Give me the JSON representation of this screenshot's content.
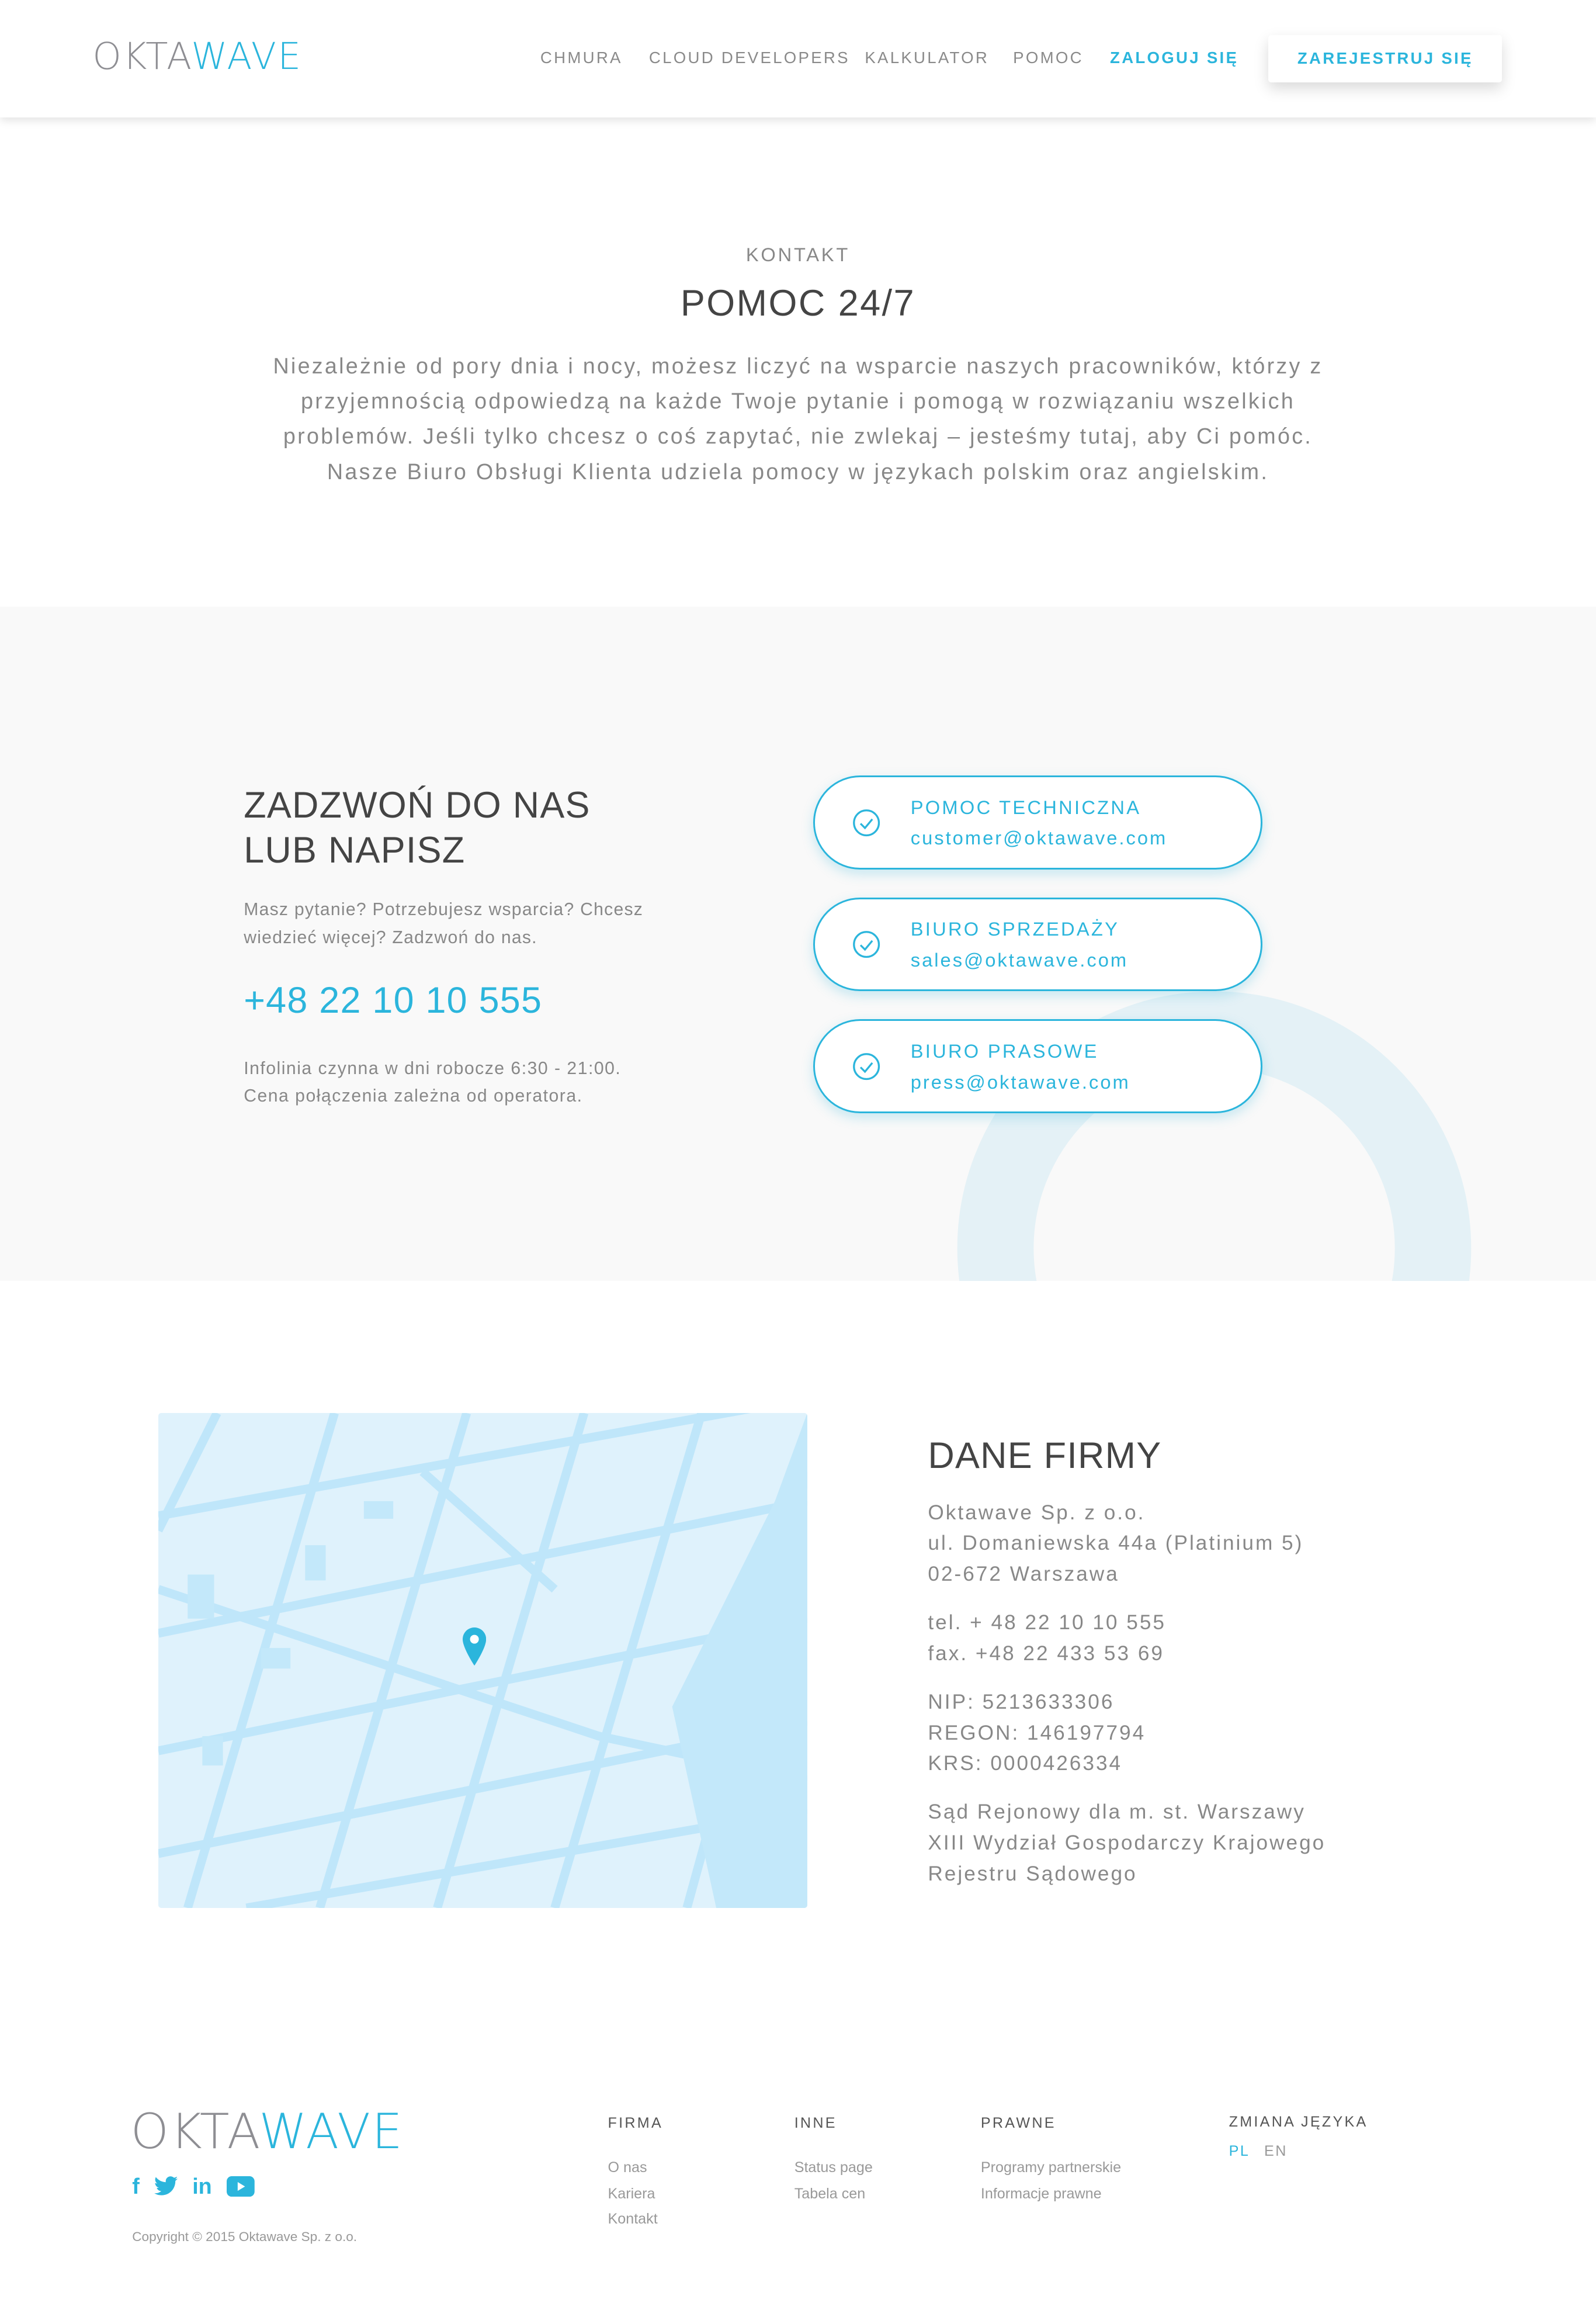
{
  "header": {
    "logo": {
      "part1": "OKTA",
      "part2": "WAVE"
    },
    "nav": [
      {
        "label": "CHMURA"
      },
      {
        "label": "CLOUD DEVELOPERS"
      },
      {
        "label": "KALKULATOR"
      },
      {
        "label": "POMOC"
      },
      {
        "label": "ZALOGUJ SIĘ"
      }
    ],
    "register_label": "ZAREJESTRUJ SIĘ"
  },
  "intro": {
    "eyebrow": "KONTAKT",
    "title": "POMOC 24/7",
    "lines": [
      "Niezależnie od pory dnia i nocy, możesz liczyć na wsparcie naszych pracowników, którzy z",
      "przyjemnością odpowiedzą na każde Twoje pytanie i pomogą w rozwiązaniu wszelkich",
      "problemów. Jeśli tylko chcesz o coś zapytać, nie zwlekaj – jesteśmy tutaj, aby Ci pomóc.",
      "Nasze Biuro Obsługi Klienta udziela pomocy w językach polskim oraz angielskim."
    ]
  },
  "contact": {
    "title_lines": [
      "ZADZWOŃ DO NAS",
      "LUB NAPISZ"
    ],
    "desc_lines": [
      "Masz pytanie? Potrzebujesz wsparcia? Chcesz",
      "wiedzieć więcej? Zadzwoń do nas."
    ],
    "phone": "+48 22 10 10 555",
    "hours_lines": [
      "Infolinia czynna w dni robocze 6:30 - 21:00.",
      "Cena połączenia zależna od operatora."
    ],
    "cards": [
      {
        "title": "POMOC TECHNICZNA",
        "email": "customer@oktawave.com",
        "icon": "check-circle-icon"
      },
      {
        "title": "BIURO SPRZEDAŻY",
        "email": "sales@oktawave.com",
        "icon": "check-circle-icon"
      },
      {
        "title": "BIURO PRASOWE",
        "email": "press@oktawave.com",
        "icon": "check-circle-icon"
      }
    ]
  },
  "company": {
    "title": "DANE FIRMY",
    "groups": [
      [
        "Oktawave Sp. z o.o.",
        "ul. Domaniewska 44a (Platinium 5)",
        "02-672 Warszawa"
      ],
      [
        "tel. + 48 22 10 10 555",
        "fax. +48 22 433 53 69"
      ],
      [
        "NIP: 5213633306",
        "REGON: 146197794",
        "KRS: 0000426334"
      ],
      [
        "Sąd Rejonowy dla m. st. Warszawy",
        "XIII Wydział Gospodarczy Krajowego",
        "Rejestru Sądowego"
      ]
    ]
  },
  "footer": {
    "logo": {
      "part1": "OKTA",
      "part2": "WAVE"
    },
    "social": [
      "facebook-icon",
      "twitter-icon",
      "linkedin-icon",
      "youtube-icon"
    ],
    "copyright": "Copyright © 2015 Oktawave Sp. z o.o.",
    "columns": [
      {
        "title": "FIRMA",
        "links": [
          "O nas",
          "Kariera",
          "Kontakt"
        ]
      },
      {
        "title": "INNE",
        "links": [
          "Status page",
          "Tabela cen"
        ]
      },
      {
        "title": "PRAWNE",
        "links": [
          "Programy partnerskie",
          "Informacje prawne"
        ]
      }
    ],
    "language": {
      "title": "ZMIANA JĘZYKA",
      "options": [
        "PL",
        "EN"
      ],
      "active": "PL"
    }
  },
  "colors": {
    "accent": "#2bb5dc",
    "gray_bg": "#f9f9f9",
    "map_bg": "#dff2fc"
  }
}
